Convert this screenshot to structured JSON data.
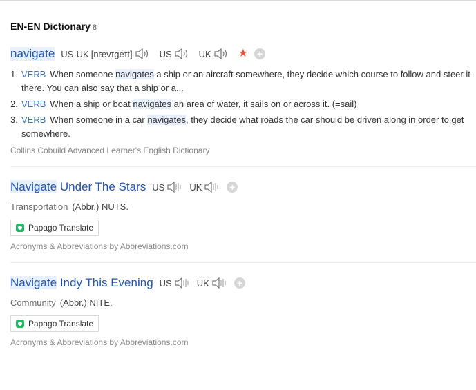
{
  "dictionary": {
    "title": "EN-EN Dictionary",
    "count": "8"
  },
  "entry1": {
    "word": "navigate",
    "pron_label": "US·UK",
    "ipa": "[nævɪgeɪt]",
    "us": "US",
    "uk": "UK",
    "senses": [
      {
        "num": "1.",
        "pos": "VERB",
        "pre": "When someone ",
        "hl": "navigates",
        "post": " a ship or an aircraft somewhere, they decide which course to follow and steer it there. You can also say that a ship or a..."
      },
      {
        "num": "2.",
        "pos": "VERB",
        "pre": "When a ship or boat ",
        "hl": "navigates",
        "post": " an area of water, it sails on or across it. (=sail)"
      },
      {
        "num": "3.",
        "pos": "VERB",
        "pre": "When someone in a car ",
        "hl": "navigates",
        "post": ", they decide what roads the car should be driven along in order to get somewhere."
      }
    ],
    "source": "Collins Cobuild Advanced Learner's English Dictionary"
  },
  "entry2": {
    "word_hl": "Navigate",
    "word_rest": " Under The Stars",
    "us": "US",
    "uk": "UK",
    "category": "Transportation",
    "abbr": "(Abbr.) NUTS.",
    "translate": "Papago Translate",
    "source": "Acronyms & Abbreviations by Abbreviations.com"
  },
  "entry3": {
    "word_hl": "Navigate",
    "word_rest": " Indy This Evening",
    "us": "US",
    "uk": "UK",
    "category": "Community",
    "abbr": "(Abbr.) NITE.",
    "translate": "Papago Translate",
    "source": "Acronyms & Abbreviations by Abbreviations.com"
  },
  "colors": {
    "link": "#1f55b5",
    "pos": "#3f73b0",
    "star": "#e8553e",
    "papago": "#1eb963"
  }
}
